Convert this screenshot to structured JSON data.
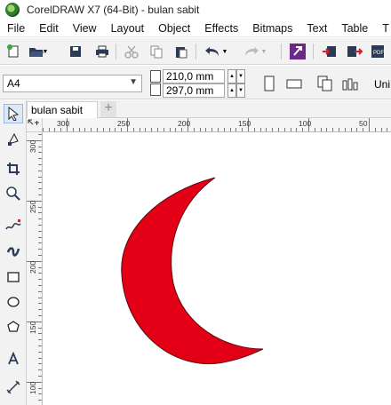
{
  "window": {
    "title": "CorelDRAW X7 (64-Bit) - bulan sabit"
  },
  "menu": {
    "items": [
      "File",
      "Edit",
      "View",
      "Layout",
      "Object",
      "Effects",
      "Bitmaps",
      "Text",
      "Table",
      "T"
    ]
  },
  "toolbar": {
    "icons": [
      "new-document-icon",
      "open-icon",
      "save-icon",
      "print-icon",
      "cut-icon",
      "copy-icon",
      "paste-icon",
      "undo-icon",
      "redo-icon",
      "corel-logo-icon",
      "import-icon",
      "export-icon",
      "publish-pdf-icon"
    ]
  },
  "property_bar": {
    "page_size": "A4",
    "width_value": "210,0 mm",
    "height_value": "297,0 mm",
    "unit_label": "Uni"
  },
  "document": {
    "tab_label": "bulan sabit",
    "add_tab_label": "+"
  },
  "ruler": {
    "h_labels": [
      "300",
      "250",
      "200",
      "150",
      "100",
      "50"
    ],
    "v_labels": [
      "300",
      "250",
      "200",
      "150",
      "100"
    ]
  },
  "canvas": {
    "shape_name": "crescent moon",
    "fill_color": "#e30016",
    "stroke_color": "#5a0a0a"
  },
  "colors": {
    "chrome_bg": "#f2f2f2",
    "accent": "#2aa3d6"
  }
}
